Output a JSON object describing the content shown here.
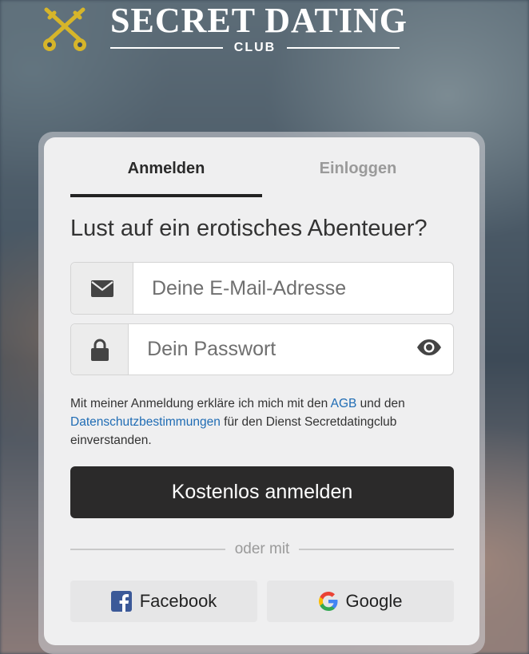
{
  "logo": {
    "title": "SECRET DATING",
    "subtitle": "CLUB",
    "icon": "crossed-keys-icon",
    "gold_color": "#d6b52a"
  },
  "tabs": {
    "signup_label": "Anmelden",
    "login_label": "Einloggen",
    "active": "Anmelden"
  },
  "headline": "Lust auf ein erotisches Abenteuer?",
  "form": {
    "email": {
      "placeholder": "Deine E-Mail-Adresse",
      "value": "",
      "icon": "envelope-icon"
    },
    "password": {
      "placeholder": "Dein Passwort",
      "value": "",
      "icon": "lock-icon",
      "toggle_icon": "eye-icon"
    }
  },
  "legal": {
    "prefix": "Mit meiner Anmeldung erkläre ich mich mit den ",
    "agb_link": "AGB",
    "middle": " und den ",
    "privacy_link": "Datenschutzbestimmungen",
    "suffix": " für den Dienst Secretdatingclub einverstanden."
  },
  "submit_label": "Kostenlos anmelden",
  "divider_text": "oder mit",
  "social": {
    "facebook_label": "Facebook",
    "google_label": "Google"
  },
  "colors": {
    "link": "#1f6cb4",
    "button_bg": "#2b2a2a",
    "facebook_blue": "#3b5998"
  }
}
